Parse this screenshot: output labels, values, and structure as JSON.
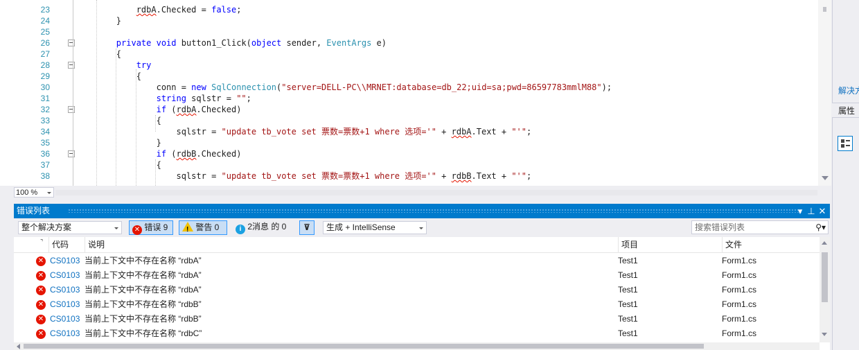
{
  "editor": {
    "lines": [
      {
        "num": "23",
        "segments": [
          {
            "t": "            ",
            "c": ""
          },
          {
            "t": "rdbA",
            "c": "sq"
          },
          {
            "t": ".Checked = ",
            "c": ""
          },
          {
            "t": "false",
            "c": "kw"
          },
          {
            "t": ";",
            "c": ""
          }
        ]
      },
      {
        "num": "24",
        "segments": [
          {
            "t": "        }",
            "c": ""
          }
        ]
      },
      {
        "num": "25",
        "segments": [
          {
            "t": "",
            "c": ""
          }
        ]
      },
      {
        "num": "26",
        "segments": [
          {
            "t": "        ",
            "c": ""
          },
          {
            "t": "private",
            "c": "kw"
          },
          {
            "t": " ",
            "c": ""
          },
          {
            "t": "void",
            "c": "kw"
          },
          {
            "t": " button1_Click(",
            "c": ""
          },
          {
            "t": "object",
            "c": "kw"
          },
          {
            "t": " sender, ",
            "c": ""
          },
          {
            "t": "EventArgs",
            "c": "ty"
          },
          {
            "t": " e)",
            "c": ""
          }
        ]
      },
      {
        "num": "27",
        "segments": [
          {
            "t": "        {",
            "c": ""
          }
        ]
      },
      {
        "num": "28",
        "segments": [
          {
            "t": "            ",
            "c": ""
          },
          {
            "t": "try",
            "c": "kw"
          }
        ]
      },
      {
        "num": "29",
        "segments": [
          {
            "t": "            {",
            "c": ""
          }
        ]
      },
      {
        "num": "30",
        "segments": [
          {
            "t": "                conn = ",
            "c": ""
          },
          {
            "t": "new",
            "c": "kw"
          },
          {
            "t": " ",
            "c": ""
          },
          {
            "t": "SqlConnection",
            "c": "ty"
          },
          {
            "t": "(",
            "c": ""
          },
          {
            "t": "\"server=DELL-PC\\\\MRNET:database=db_22;uid=sa;pwd=86597783mmlM88\"",
            "c": "st"
          },
          {
            "t": ");",
            "c": ""
          }
        ]
      },
      {
        "num": "31",
        "segments": [
          {
            "t": "                ",
            "c": ""
          },
          {
            "t": "string",
            "c": "kw"
          },
          {
            "t": " sqlstr = ",
            "c": ""
          },
          {
            "t": "\"\"",
            "c": "st"
          },
          {
            "t": ";",
            "c": ""
          }
        ]
      },
      {
        "num": "32",
        "segments": [
          {
            "t": "                ",
            "c": ""
          },
          {
            "t": "if",
            "c": "kw"
          },
          {
            "t": " (",
            "c": ""
          },
          {
            "t": "rdbA",
            "c": "sq"
          },
          {
            "t": ".Checked)",
            "c": ""
          }
        ]
      },
      {
        "num": "33",
        "segments": [
          {
            "t": "                {",
            "c": ""
          }
        ]
      },
      {
        "num": "34",
        "segments": [
          {
            "t": "                    sqlstr = ",
            "c": ""
          },
          {
            "t": "\"update tb_vote set 票数=票数+1 where 选项='\"",
            "c": "st"
          },
          {
            "t": " + ",
            "c": ""
          },
          {
            "t": "rdbA",
            "c": "sq"
          },
          {
            "t": ".Text + ",
            "c": ""
          },
          {
            "t": "\"'\"",
            "c": "st"
          },
          {
            "t": ";",
            "c": ""
          }
        ]
      },
      {
        "num": "35",
        "segments": [
          {
            "t": "                }",
            "c": ""
          }
        ]
      },
      {
        "num": "36",
        "segments": [
          {
            "t": "                ",
            "c": ""
          },
          {
            "t": "if",
            "c": "kw"
          },
          {
            "t": " (",
            "c": ""
          },
          {
            "t": "rdbB",
            "c": "sq"
          },
          {
            "t": ".Checked)",
            "c": ""
          }
        ]
      },
      {
        "num": "37",
        "segments": [
          {
            "t": "                {",
            "c": ""
          }
        ]
      },
      {
        "num": "38",
        "segments": [
          {
            "t": "                    sqlstr = ",
            "c": ""
          },
          {
            "t": "\"update tb_vote set 票数=票数+1 where 选项='\"",
            "c": "st"
          },
          {
            "t": " + ",
            "c": ""
          },
          {
            "t": "rdbB",
            "c": "sq"
          },
          {
            "t": ".Text + ",
            "c": ""
          },
          {
            "t": "\"'\"",
            "c": "st"
          },
          {
            "t": ";",
            "c": ""
          }
        ]
      }
    ],
    "zoom": "100 %"
  },
  "right_panel": {
    "solution_label": "解决方",
    "properties_label": "属性"
  },
  "error_list": {
    "title": "错误列表",
    "scope": "整个解决方案",
    "errors_label": "错误 9",
    "warnings_label": "警告 0",
    "messages_label": "2消息 的 0",
    "build_filter": "生成 + IntelliSense",
    "search_placeholder": "搜索错误列表",
    "columns": {
      "code": "代码",
      "description": "说明",
      "project": "项目",
      "file": "文件"
    },
    "rows": [
      {
        "code": "CS0103",
        "description": "当前上下文中不存在名称 “rdbA”",
        "project": "Test1",
        "file": "Form1.cs"
      },
      {
        "code": "CS0103",
        "description": "当前上下文中不存在名称 “rdbA”",
        "project": "Test1",
        "file": "Form1.cs"
      },
      {
        "code": "CS0103",
        "description": "当前上下文中不存在名称 “rdbA”",
        "project": "Test1",
        "file": "Form1.cs"
      },
      {
        "code": "CS0103",
        "description": "当前上下文中不存在名称 “rdbB”",
        "project": "Test1",
        "file": "Form1.cs"
      },
      {
        "code": "CS0103",
        "description": "当前上下文中不存在名称 “rdbB”",
        "project": "Test1",
        "file": "Form1.cs"
      },
      {
        "code": "CS0103",
        "description": "当前上下文中不存在名称 “rdbC”",
        "project": "Test1",
        "file": "Form1.cs"
      }
    ]
  },
  "colors": {
    "accent": "#007acc",
    "error": "#e51400",
    "keyword": "#0000ff",
    "type": "#2b91af",
    "string": "#a31515"
  }
}
